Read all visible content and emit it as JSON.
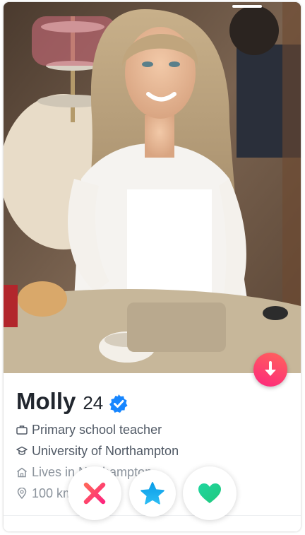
{
  "profile": {
    "name": "Molly",
    "age": "24",
    "job": "Primary school teacher",
    "school": "University of Northampton",
    "lives": "Lives in Northampton",
    "distance": "100 km away"
  },
  "icons": {
    "verified": "verified-badge-icon",
    "job": "briefcase-icon",
    "school": "graduation-cap-icon",
    "home": "home-icon",
    "location": "location-pin-icon",
    "open_profile": "arrow-down-icon",
    "nope": "x-icon",
    "super_like": "star-icon",
    "like": "heart-icon"
  },
  "colors": {
    "verified": "#1786ff",
    "nope": "#fd267d",
    "super_like": "#1da1f2",
    "like": "#21d07c",
    "open_profile_start": "#ff655b",
    "open_profile_end": "#fd267d"
  }
}
